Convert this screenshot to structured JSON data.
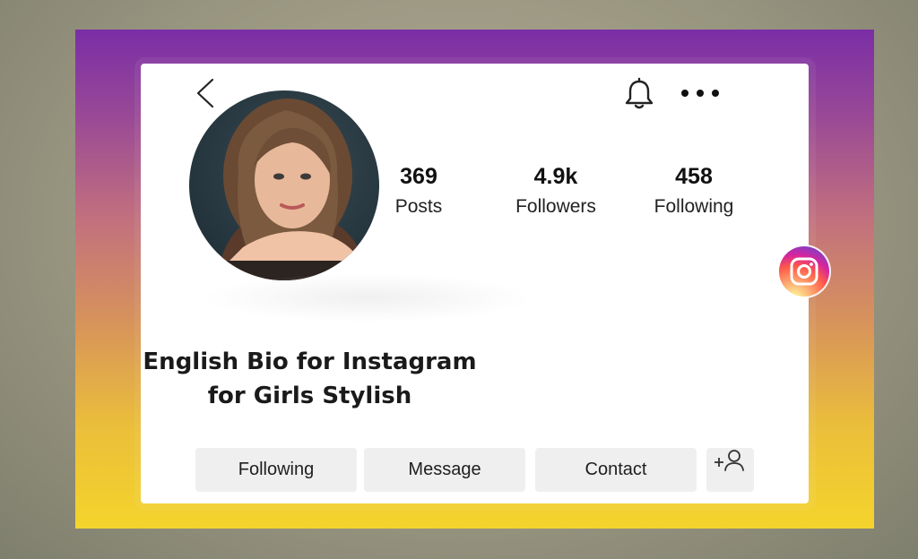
{
  "profile": {
    "stats": {
      "posts": {
        "value": "369",
        "label": "Posts"
      },
      "followers": {
        "value": "4.9k",
        "label": "Followers"
      },
      "following": {
        "value": "458",
        "label": "Following"
      }
    }
  },
  "headline": {
    "line1": "English Bio for Instagram",
    "line2": "for Girls Stylish"
  },
  "actions": {
    "following_label": "Following",
    "message_label": "Message",
    "contact_label": "Contact"
  },
  "icons": {
    "back": "back-chevron-icon",
    "notifications": "bell-icon",
    "more": "more-dots-icon",
    "add_user": "add-user-icon",
    "brand": "instagram-logo-icon"
  },
  "colors": {
    "frame_top": "#7a2ea6",
    "frame_bottom": "#f4d42c",
    "button_bg": "#efefef",
    "card_bg": "#ffffff"
  }
}
